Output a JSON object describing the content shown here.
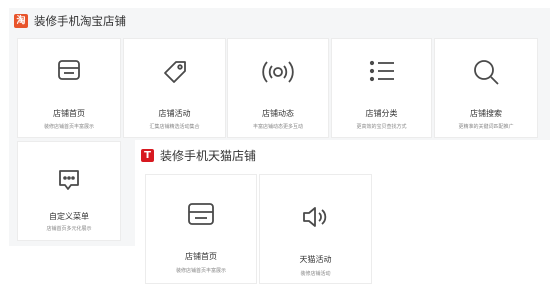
{
  "accent_color": "#e8542b",
  "tmall_color": "#d71920",
  "taobao": {
    "badge": "淘",
    "title": "装修手机淘宝店铺",
    "cards": [
      {
        "label": "店铺首页",
        "desc": "装修店铺首页丰富展示",
        "icon": "storefront-icon"
      },
      {
        "label": "店铺活动",
        "desc": "汇集店铺精选活动集合",
        "icon": "tag-icon"
      },
      {
        "label": "店铺动态",
        "desc": "丰富店铺动态更多互动",
        "icon": "broadcast-icon"
      },
      {
        "label": "店铺分类",
        "desc": "更高效的宝贝查找方式",
        "icon": "list-icon"
      },
      {
        "label": "店铺搜索",
        "desc": "更精准的关键词匹配推广",
        "icon": "search-icon"
      },
      {
        "label": "自定义菜单",
        "desc": "店铺首页多元化展示",
        "icon": "chat-menu-icon"
      }
    ]
  },
  "tmall": {
    "badge": "T",
    "title": "装修手机天猫店铺",
    "cards": [
      {
        "label": "店铺首页",
        "desc": "装修店铺首页丰富展示",
        "icon": "storefront-icon"
      },
      {
        "label": "天猫活动",
        "desc": "装修店铺活动",
        "icon": "speaker-icon"
      }
    ]
  }
}
